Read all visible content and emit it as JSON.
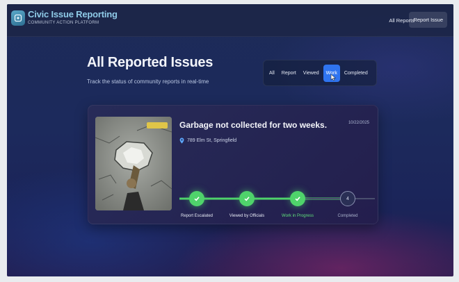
{
  "brand": {
    "title": "Civic Issue Reporting",
    "subtitle": "COMMUNITY ACTION PLATFORM"
  },
  "nav": {
    "all_reports": "All Reports",
    "report_issue": "Report Issue"
  },
  "page": {
    "title": "All Reported Issues",
    "subtitle": "Track the status of community reports in real-time"
  },
  "filters": [
    {
      "label": "All",
      "active": false
    },
    {
      "label": "Report",
      "active": false
    },
    {
      "label": "Viewed",
      "active": false
    },
    {
      "label": "Work",
      "active": true
    },
    {
      "label": "Completed",
      "active": false
    }
  ],
  "issue": {
    "title": "Garbage not collected for two weeks.",
    "date": "10/22/2025",
    "location": "789 Elm St, Springfield",
    "photo_tag": "",
    "steps": [
      {
        "label": "Report Escalated",
        "status": "done"
      },
      {
        "label": "Viewed by Officials",
        "status": "done"
      },
      {
        "label": "Work in Progress",
        "status": "current"
      },
      {
        "label": "Completed",
        "status": "pending",
        "number": "4"
      }
    ]
  },
  "colors": {
    "accent": "#2f74f0",
    "step_done": "#4fd36b",
    "brand": "#8fcbe8"
  },
  "icons": [
    "logo-icon",
    "location-pin-icon",
    "check-icon",
    "cursor-icon"
  ]
}
